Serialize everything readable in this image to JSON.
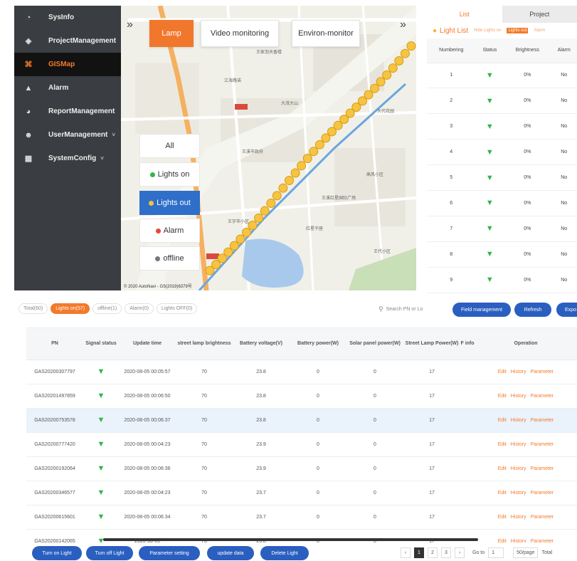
{
  "sidebar": {
    "items": [
      {
        "label": "SysInfo",
        "icon": "dashboard-icon",
        "glyph": "◔"
      },
      {
        "label": "ProjectManagement",
        "icon": "layers-icon",
        "glyph": "◈"
      },
      {
        "label": "GISMap",
        "icon": "map-pin-icon",
        "glyph": "⌘",
        "active": true
      },
      {
        "label": "Alarm",
        "icon": "bell-icon",
        "glyph": "▲"
      },
      {
        "label": "ReportManagement",
        "icon": "pie-chart-icon",
        "glyph": "◕"
      },
      {
        "label": "UserManagement",
        "icon": "user-icon",
        "glyph": "☻",
        "caret": "˅"
      },
      {
        "label": "SystemConfig",
        "icon": "grid-icon",
        "glyph": "▦",
        "caret": "˅"
      }
    ]
  },
  "map": {
    "tabs": {
      "lamp": "Lamp",
      "video": "Video monitoring",
      "environ": "Environ-monitor"
    },
    "collapse_left": "»",
    "collapse_right": "»",
    "filters": {
      "all": "All",
      "on": "Lights on",
      "out": "Lights out",
      "alarm": "Alarm",
      "offline": "offline"
    },
    "labels": [
      "王家泡天香楼",
      "江海路诺",
      "王溪市政府",
      "大茂大山",
      "高风小区",
      "王溪红星国际广场",
      "红星干座",
      "王宇市小区",
      "大代花园",
      "王代小区"
    ],
    "copyright": "© 2020 AutoNavi - GS(2019)6379号"
  },
  "light_list": {
    "tab_list": "List",
    "tab_project": "Project",
    "title": "Light List",
    "legend": [
      "Hide Lights on",
      "Lights out",
      "Alarm"
    ],
    "columns": [
      "Numbering",
      "Status",
      "Brightness",
      "Alarm"
    ],
    "rows": [
      {
        "num": "1",
        "bright": "0%",
        "alarm": "No"
      },
      {
        "num": "2",
        "bright": "0%",
        "alarm": "No"
      },
      {
        "num": "3",
        "bright": "0%",
        "alarm": "No"
      },
      {
        "num": "4",
        "bright": "0%",
        "alarm": "No"
      },
      {
        "num": "5",
        "bright": "0%",
        "alarm": "No"
      },
      {
        "num": "6",
        "bright": "0%",
        "alarm": "No"
      },
      {
        "num": "7",
        "bright": "0%",
        "alarm": "No"
      },
      {
        "num": "8",
        "bright": "0%",
        "alarm": "No"
      },
      {
        "num": "9",
        "bright": "0%",
        "alarm": "No"
      }
    ]
  },
  "status_tabs": [
    "Total(60)",
    "Lights on(57)",
    "offline(1)",
    "Alarm(0)",
    "Lights OFF(0)"
  ],
  "search_placeholder": "Search PN or Lo",
  "toolbar": {
    "field": "Field management",
    "refresh": "Refresh",
    "export": "Expo"
  },
  "table": {
    "columns": [
      "PN",
      "Signal status",
      "Update time",
      "street lamp brightness",
      "Battery voltage(V)",
      "Battery power(W)",
      "Solar panel power(W)",
      "Street Lamp Power(W)",
      "F info",
      "Operation"
    ],
    "ops": [
      "Edit",
      "History",
      "Parameter"
    ],
    "rows": [
      {
        "pn": "GAS20200307797",
        "time": "2020-08-05 00:05:57",
        "bright": "70",
        "volt": "23.8",
        "bpow": "0",
        "solar": "0",
        "lamp": "17"
      },
      {
        "pn": "GAS20201497859",
        "time": "2020-08-05 00:06:50",
        "bright": "70",
        "volt": "23.8",
        "bpow": "0",
        "solar": "0",
        "lamp": "17"
      },
      {
        "pn": "GAS20200753578",
        "time": "2020-08-05 00:06:37",
        "bright": "70",
        "volt": "23.8",
        "bpow": "0",
        "solar": "0",
        "lamp": "17",
        "hl": true
      },
      {
        "pn": "GAS20200777420",
        "time": "2020-08-05 00:04:23",
        "bright": "70",
        "volt": "23.9",
        "bpow": "0",
        "solar": "0",
        "lamp": "17"
      },
      {
        "pn": "GAS20200192064",
        "time": "2020-08-05 00:06:36",
        "bright": "70",
        "volt": "23.9",
        "bpow": "0",
        "solar": "0",
        "lamp": "17"
      },
      {
        "pn": "GAS20200346577",
        "time": "2020-08-05 00:04:23",
        "bright": "70",
        "volt": "23.7",
        "bpow": "0",
        "solar": "0",
        "lamp": "17"
      },
      {
        "pn": "GAS20200615601",
        "time": "2020-08-05 00:06:34",
        "bright": "70",
        "volt": "23.7",
        "bpow": "0",
        "solar": "0",
        "lamp": "17"
      },
      {
        "pn": "GAS20200142065",
        "time": "2020-08-05",
        "bright": "70",
        "volt": "23.8",
        "bpow": "0",
        "solar": "0",
        "lamp": "17"
      }
    ]
  },
  "actions": [
    "Turn on Light",
    "Turn off Light",
    "Parameter setting",
    "update data",
    "Delete Light"
  ],
  "pagination": {
    "prev": "‹",
    "pages": [
      "1",
      "2",
      "3"
    ],
    "next": "›",
    "goto_label": "Go to",
    "goto_value": "1",
    "per_page": "50/page",
    "total": "Total"
  },
  "colors": {
    "accent": "#f27a2a",
    "primary": "#2a5fc0",
    "sidebar": "#3a3d41",
    "signal": "#35b44a"
  }
}
